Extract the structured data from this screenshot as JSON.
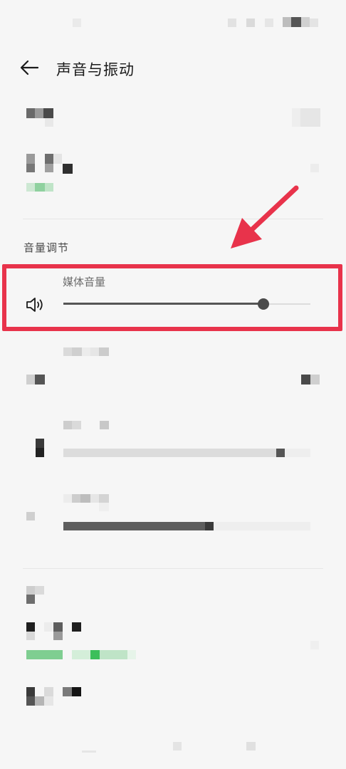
{
  "header": {
    "back_icon": "arrow-left-icon",
    "title": "声音与振动"
  },
  "volume_section": {
    "title": "音量调节",
    "media_volume": {
      "label": "媒体音量",
      "icon": "speaker-icon",
      "level": 0.81
    },
    "other_sliders": [
      {
        "level": 0.88
      },
      {
        "level": 0.59
      }
    ]
  },
  "annotation": {
    "box_color": "#e8334b",
    "arrow_color": "#e8334b"
  },
  "colors": {
    "background": "#f6f6f6",
    "accent_green": "#3cbf5a",
    "slider_dark": "#4a4a4a"
  }
}
